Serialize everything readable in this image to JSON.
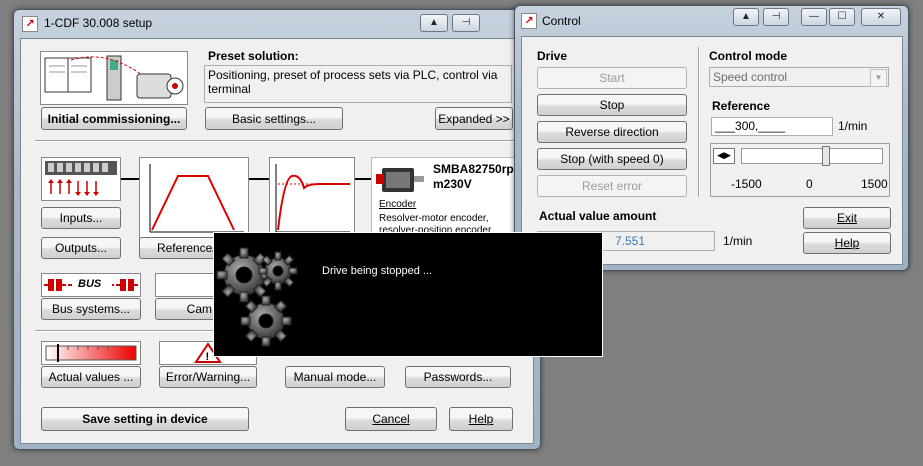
{
  "setup_window": {
    "title": "1-CDF 30.008 setup",
    "icon": "lenze-logo-icon",
    "preset_label": "Preset solution:",
    "preset_value": "Positioning, preset of process sets via PLC, control via terminal",
    "initial_commissioning": "Initial commissioning...",
    "basic_settings": "Basic settings...",
    "expanded": "Expanded >>",
    "inputs": "Inputs...",
    "outputs": "Outputs...",
    "reference_ramp": "Reference/Ra",
    "bus_systems": "Bus systems...",
    "bus_label": "BUS",
    "cam": "Cam",
    "motor_name": "SMBA82750rp",
    "motor_voltage": "m230V",
    "encoder_heading": "Encoder",
    "encoder_line1": "Resolver-motor encoder,",
    "encoder_line2": "resolver-position encoder",
    "actual_values": "Actual values ...",
    "error_warning": "Error/Warning...",
    "manual_mode": "Manual mode...",
    "passwords": "Passwords...",
    "save_setting": "Save setting in device",
    "cancel": "Cancel",
    "help": "Help"
  },
  "control_window": {
    "title": "Control",
    "icon": "lenze-logo-icon",
    "drive_heading": "Drive",
    "start": "Start",
    "stop": "Stop",
    "reverse_direction": "Reverse direction",
    "stop_with_speed": "Stop (with speed 0)",
    "reset_error": "Reset error",
    "control_mode_heading": "Control mode",
    "control_mode_value": "Speed control",
    "reference_heading": "Reference",
    "reference_value": "___300,____",
    "reference_unit": "1/min",
    "slider_min": "-1500",
    "slider_mid": "0",
    "slider_max": "1500",
    "slider_value_rpm": 300,
    "actual_value_heading": "Actual value amount",
    "actual_value": "7.551",
    "actual_value_unit": "1/min",
    "exit": "Exit",
    "help": "Help"
  },
  "busy_dialog": {
    "message": "Drive being stopped ...",
    "icon": "gears-icon"
  }
}
